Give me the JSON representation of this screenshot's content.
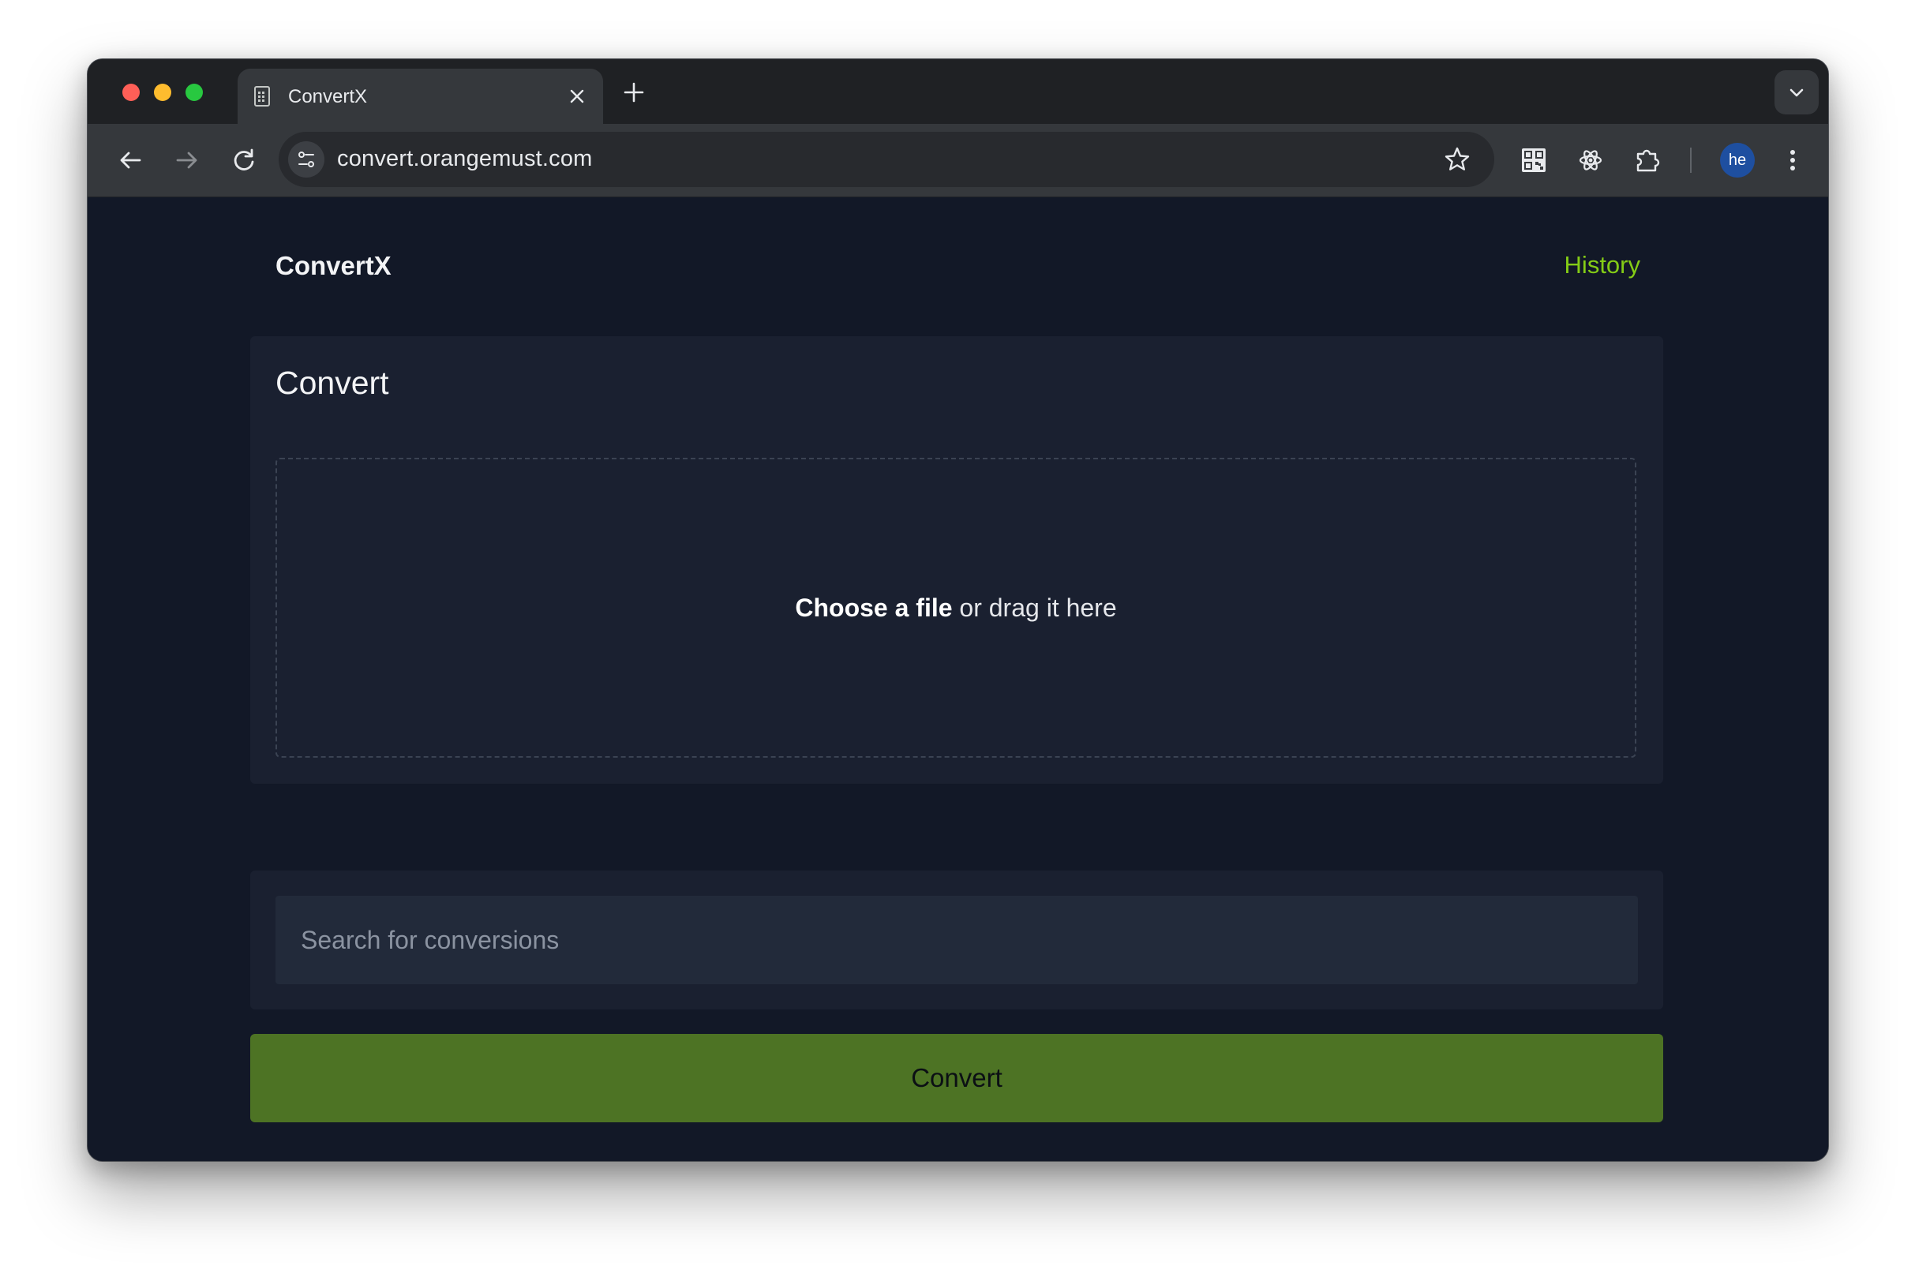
{
  "browser": {
    "tab": {
      "title": "ConvertX",
      "favicon": "document-icon"
    },
    "address": {
      "url": "convert.orangemust.com"
    },
    "profile": {
      "initials": "he"
    },
    "extensions": [
      "qr-code-icon",
      "atom-icon",
      "puzzle-icon"
    ]
  },
  "header": {
    "brand": "ConvertX",
    "history_link": "History"
  },
  "convert_card": {
    "title": "Convert",
    "dropzone_strong": "Choose a file",
    "dropzone_rest": " or drag it here"
  },
  "search": {
    "placeholder": "Search for conversions",
    "value": ""
  },
  "actions": {
    "convert_label": "Convert"
  },
  "colors": {
    "page_bg": "#121827",
    "card_bg": "#1a2030",
    "accent_link": "#84cc16",
    "convert_button": "#4d7324"
  }
}
